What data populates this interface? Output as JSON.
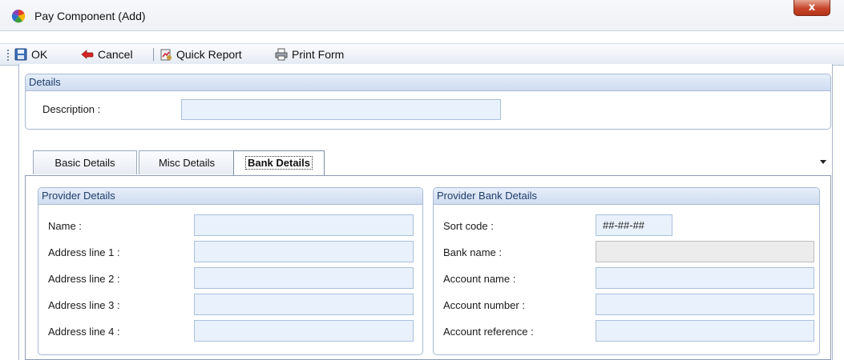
{
  "window": {
    "title": "Pay Component (Add)",
    "close_glyph": "x"
  },
  "toolbar": {
    "ok_label": "OK",
    "cancel_label": "Cancel",
    "quick_report_label": "Quick Report",
    "print_form_label": "Print Form"
  },
  "details": {
    "header": "Details",
    "description_label": "Description :",
    "description_value": ""
  },
  "tabs": [
    {
      "label": "Basic Details",
      "active": false
    },
    {
      "label": "Misc Details",
      "active": false
    },
    {
      "label": "Bank Details",
      "active": true
    }
  ],
  "provider": {
    "header": "Provider Details",
    "name_label": "Name :",
    "address1_label": "Address line 1 :",
    "address2_label": "Address line 2 :",
    "address3_label": "Address line 3 :",
    "address4_label": "Address line 4 :"
  },
  "bank": {
    "header": "Provider Bank Details",
    "sort_code_label": "Sort code :",
    "sort_code_value": "##-##-##",
    "bank_name_label": "Bank name :",
    "account_name_label": "Account name :",
    "account_number_label": "Account number :",
    "account_reference_label": "Account reference :"
  },
  "icons": {
    "app": "pinwheel-icon",
    "ok": "save-icon",
    "cancel": "back-arrow-icon",
    "quick_report": "report-icon",
    "print_form": "print-icon"
  }
}
